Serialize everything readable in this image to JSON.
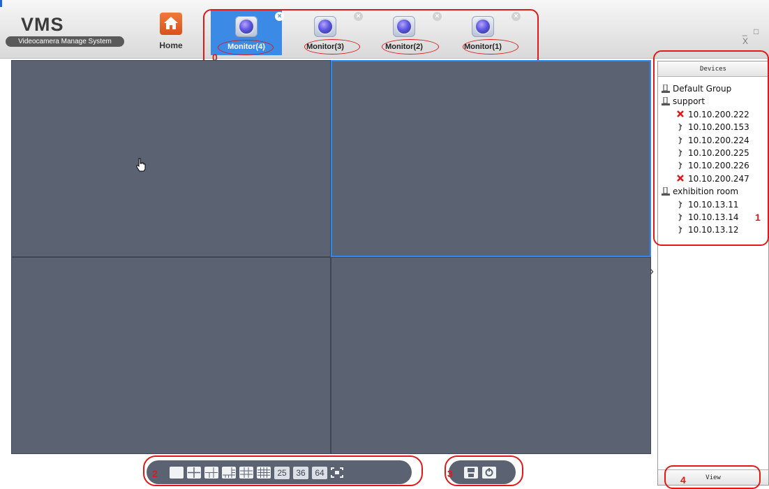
{
  "brand": {
    "title": "VMS",
    "subtitle": "Videocamera Manage System"
  },
  "home": {
    "label": "Home",
    "icon": "home-icon"
  },
  "tabs": [
    {
      "label": "Monitor(4)",
      "active": true
    },
    {
      "label": "Monitor(3)",
      "active": false
    },
    {
      "label": "Monitor(2)",
      "active": false
    },
    {
      "label": "Monitor(1)",
      "active": false
    }
  ],
  "window_controls": "_ □ X",
  "annotations": {
    "n0": "0",
    "n1": "1",
    "n2": "2",
    "n3": "3",
    "n4": "4",
    "accent": "#e01818"
  },
  "devices": {
    "header": "Devices",
    "footer": "View",
    "tree": [
      {
        "type": "group",
        "label": "Default Group"
      },
      {
        "type": "group",
        "label": "support"
      },
      {
        "type": "device",
        "label": "10.10.200.222",
        "status": "offline"
      },
      {
        "type": "device",
        "label": "10.10.200.153",
        "status": "online"
      },
      {
        "type": "device",
        "label": "10.10.200.224",
        "status": "online"
      },
      {
        "type": "device",
        "label": "10.10.200.225",
        "status": "online"
      },
      {
        "type": "device",
        "label": "10.10.200.226",
        "status": "online"
      },
      {
        "type": "device",
        "label": "10.10.200.247",
        "status": "offline"
      },
      {
        "type": "group",
        "label": "exhibition room"
      },
      {
        "type": "device",
        "label": "10.10.13.11",
        "status": "online"
      },
      {
        "type": "device",
        "label": "10.10.13.14",
        "status": "online"
      },
      {
        "type": "device",
        "label": "10.10.13.12",
        "status": "online"
      }
    ]
  },
  "layout_toolbar": {
    "n25": "25",
    "n36": "36",
    "n64": "64"
  },
  "colors": {
    "pane": "#5b6373",
    "selected_border": "#2e88f0",
    "active_tab": "#3b8ae6"
  }
}
